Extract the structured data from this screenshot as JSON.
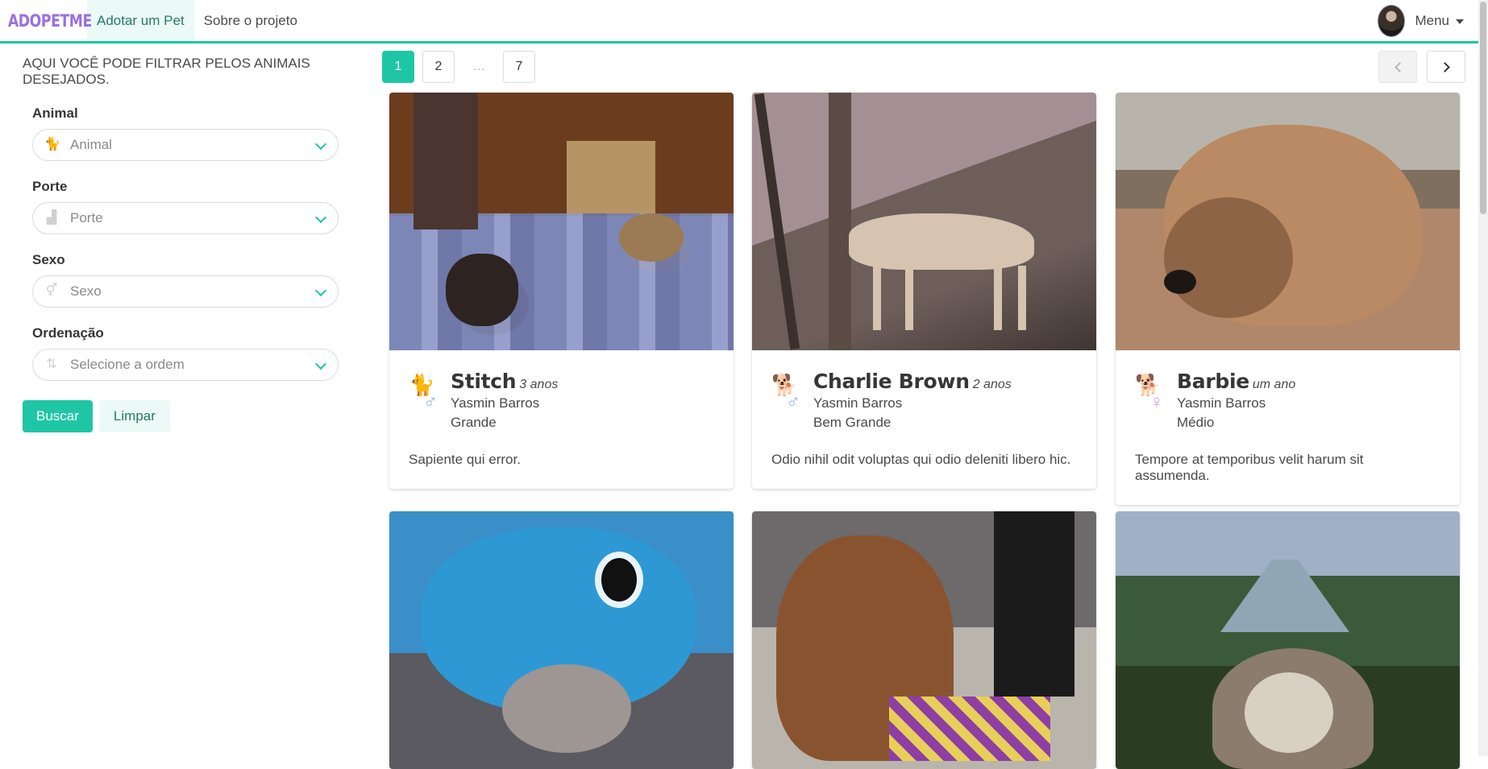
{
  "app": {
    "brand": "ADOPETME",
    "nav": [
      {
        "label": "Adotar um Pet",
        "active": true
      },
      {
        "label": "Sobre o projeto",
        "active": false
      }
    ],
    "menu_label": "Menu"
  },
  "colors": {
    "accent": "#1fc6a5",
    "brand": "#9b6fe0",
    "male": "#9fb5d6",
    "female": "#c7a4e6"
  },
  "sidebar": {
    "intro": "AQUI VOCÊ PODE FILTRAR PELOS ANIMAIS DESEJADOS.",
    "filters": [
      {
        "label": "Animal",
        "placeholder": "Animal",
        "icon": "cat-outline-icon"
      },
      {
        "label": "Porte",
        "placeholder": "Porte",
        "icon": "ruler-icon"
      },
      {
        "label": "Sexo",
        "placeholder": "Sexo",
        "icon": "gender-icon"
      },
      {
        "label": "Ordenação",
        "placeholder": "Selecione a ordem",
        "icon": "sort-icon"
      }
    ],
    "search_button": "Buscar",
    "clear_button": "Limpar"
  },
  "pagination": {
    "pages": [
      "1",
      "2"
    ],
    "ellipsis": "…",
    "last": "7",
    "current": "1"
  },
  "cards": [
    {
      "name": "Stitch",
      "age": "3 anos",
      "owner": "Yasmin Barros",
      "size": "Grande",
      "description": "Sapiente qui error.",
      "species": "cat",
      "sex": "male"
    },
    {
      "name": "Charlie Brown",
      "age": "2 anos",
      "owner": "Yasmin Barros",
      "size": "Bem Grande",
      "description": "Odio nihil odit voluptas qui odio deleniti libero hic.",
      "species": "dog",
      "sex": "male"
    },
    {
      "name": "Barbie",
      "age": "um ano",
      "owner": "Yasmin Barros",
      "size": "Médio",
      "description": "Tempore at temporibus velit harum sit assumenda.",
      "species": "dog",
      "sex": "female"
    }
  ]
}
